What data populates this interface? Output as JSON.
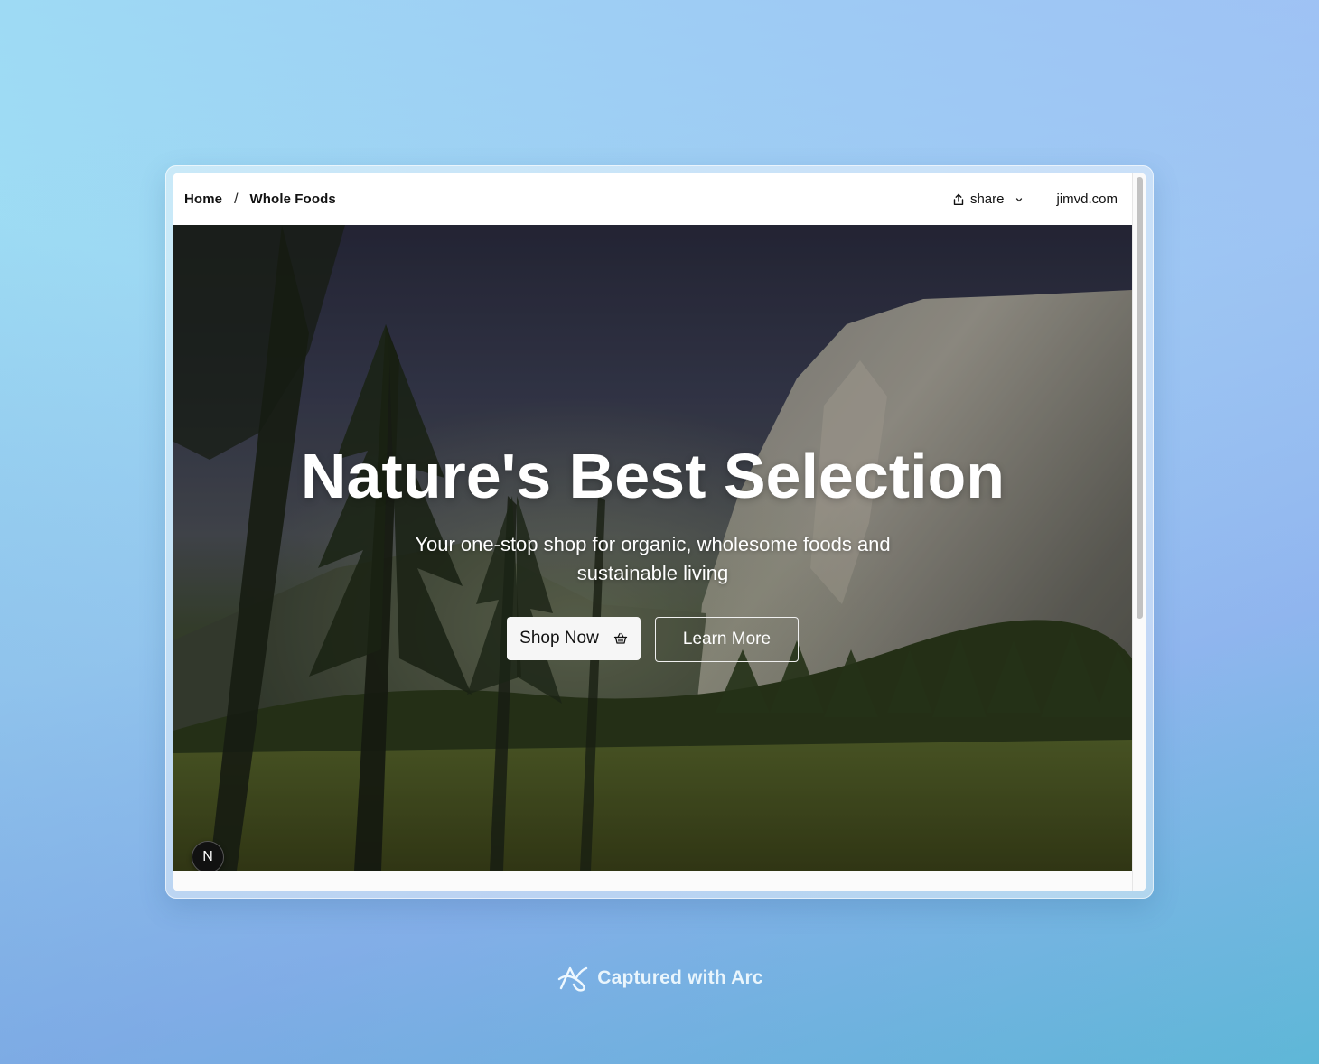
{
  "breadcrumb": {
    "home": "Home",
    "separator": "/",
    "current": "Whole Foods"
  },
  "topbar": {
    "share_label": "share",
    "site_label": "jimvd.com"
  },
  "hero": {
    "title": "Nature's Best Selection",
    "subtitle": "Your one-stop shop for organic, wholesome foods and sustainable living",
    "primary_button": "Shop Now",
    "secondary_button": "Learn More"
  },
  "badge": {
    "letter": "N"
  },
  "footer": {
    "caption": "Captured with Arc"
  },
  "icons": {
    "share": "share-icon",
    "chevron": "chevron-down-icon",
    "basket": "basket-icon",
    "arc": "arc-logo-icon"
  },
  "colors": {
    "primary_button_bg": "#f6f6f6",
    "badge_bg": "#111111"
  }
}
